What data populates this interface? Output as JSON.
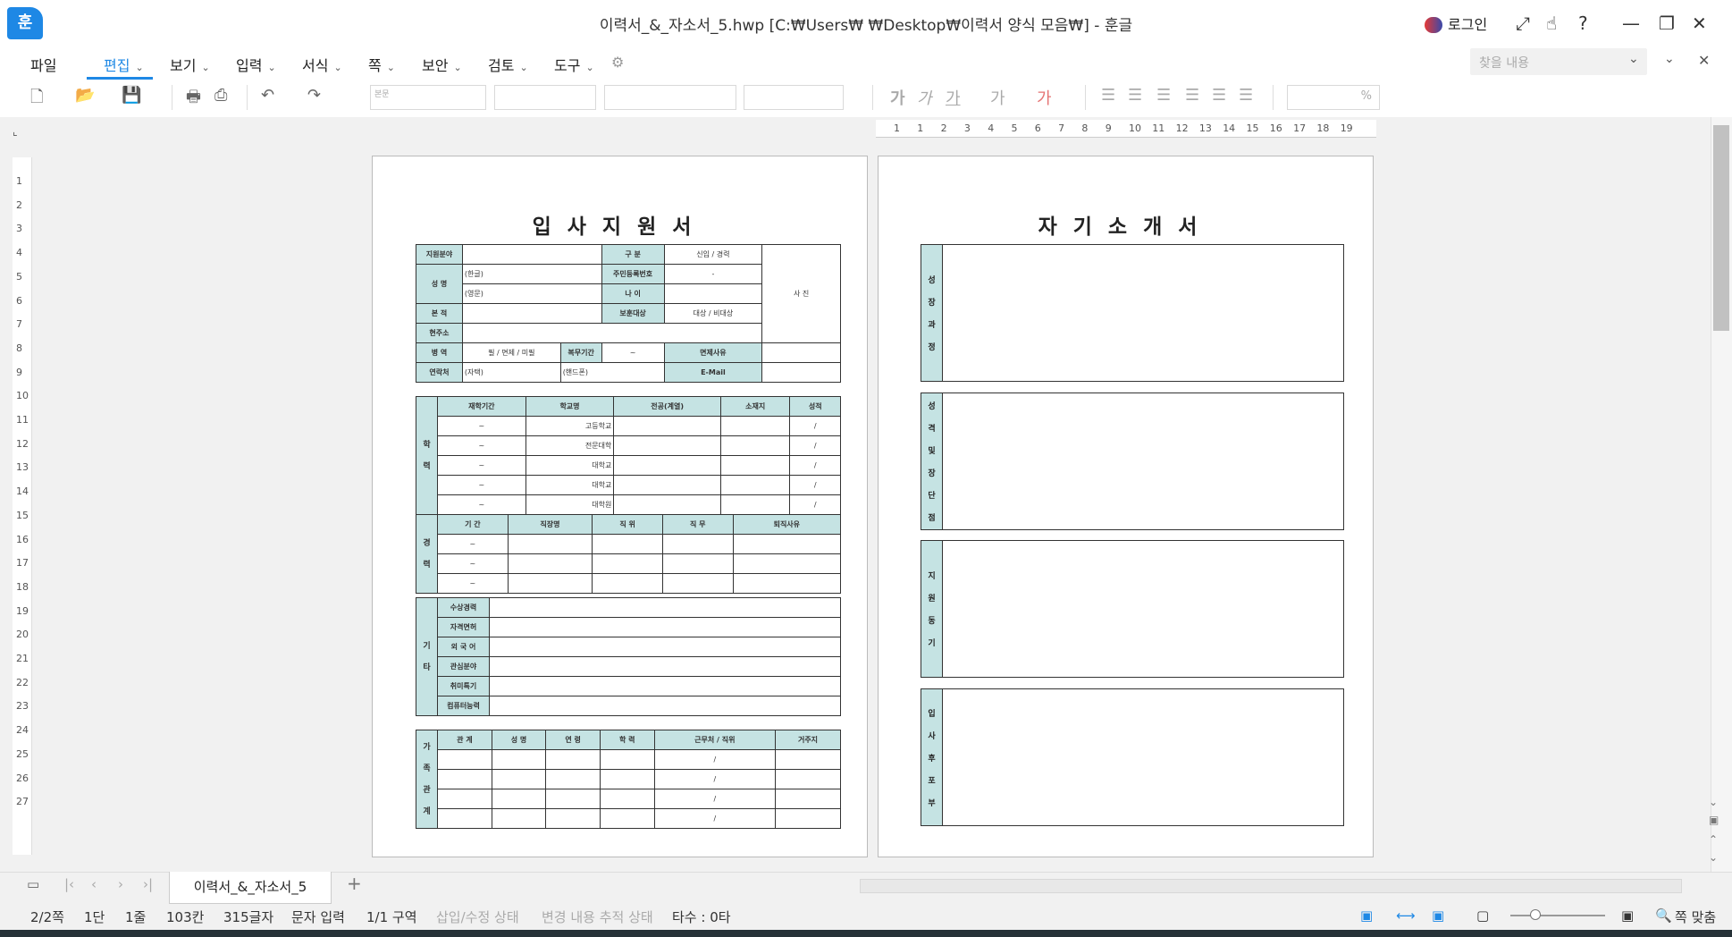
{
  "window": {
    "title": "이력서_&_자소서_5.hwp [C:₩Users₩      ₩Desktop₩이력서 양식 모음₩] - 훈글",
    "logo_glyph": "훈",
    "login": "로그인",
    "controls": {
      "fullscreen": "⤢",
      "touch": "☝",
      "help": "?",
      "minimize": "—",
      "restore": "❐",
      "close": "✕"
    }
  },
  "menu": {
    "items": [
      "파일",
      "편집",
      "보기",
      "입력",
      "서식",
      "쪽",
      "보안",
      "검토",
      "도구"
    ],
    "active": "편집",
    "search_placeholder": "찾을 내용"
  },
  "toolbar": {
    "style_value": "본문",
    "font_units": "%"
  },
  "ruler": {
    "h_numbers": [
      "1",
      "1",
      "2",
      "3",
      "4",
      "5",
      "6",
      "7",
      "8",
      "9",
      "10",
      "11",
      "12",
      "13",
      "14",
      "15",
      "16",
      "17",
      "18",
      "19"
    ],
    "v_numbers": [
      "1",
      "2",
      "3",
      "4",
      "5",
      "6",
      "7",
      "8",
      "9",
      "10",
      "11",
      "12",
      "13",
      "14",
      "15",
      "16",
      "17",
      "18",
      "19",
      "20",
      "21",
      "22",
      "23",
      "24",
      "25",
      "26",
      "27"
    ]
  },
  "form": {
    "title": "입사지원서",
    "info": {
      "field_label": "지원분야",
      "category_label": "구    분",
      "category_value": "신입 / 경력",
      "name_label": "성    명",
      "name_ko": "(한글)",
      "name_en": "(영문)",
      "id_label": "주민등록번호",
      "id_value": "-",
      "age_label": "나    이",
      "origin_label": "본    적",
      "veteran_label": "보훈대상",
      "veteran_value": "대상 / 비대상",
      "address_label": "현주소",
      "photo_label": "사 진",
      "military_label": "병    역",
      "military_value": "필 / 면제 / 미필",
      "service_label": "복무기간",
      "service_value": "~",
      "exempt_label": "면제사유",
      "contact_label": "연락처",
      "home": "(자택)",
      "mobile": "(핸드폰)",
      "email_label": "E-Mail"
    },
    "education": {
      "side": "학력",
      "headers": [
        "재학기간",
        "학교명",
        "전공(계열)",
        "소재지",
        "성적"
      ],
      "rows": [
        [
          "~",
          "고등학교",
          "",
          "",
          "/"
        ],
        [
          "~",
          "전문대학",
          "",
          "",
          "/"
        ],
        [
          "~",
          "대학교",
          "",
          "",
          "/"
        ],
        [
          "~",
          "대학교",
          "",
          "",
          "/"
        ],
        [
          "~",
          "대학원",
          "",
          "",
          "/"
        ]
      ]
    },
    "career": {
      "side": "경력",
      "headers": [
        "기 간",
        "직장명",
        "직 위",
        "직 무",
        "퇴직사유"
      ],
      "rows": [
        [
          "~",
          "",
          "",
          "",
          ""
        ],
        [
          "~",
          "",
          "",
          "",
          ""
        ],
        [
          "~",
          "",
          "",
          "",
          ""
        ]
      ]
    },
    "other": {
      "side": "기타",
      "labels": [
        "수상경력",
        "자격면허",
        "외 국 어",
        "관심분야",
        "취미특기",
        "컴퓨터능력"
      ]
    },
    "family": {
      "side": "가족관계",
      "headers": [
        "관 계",
        "성 명",
        "연 령",
        "학 력",
        "근무처 / 직위",
        "거주지"
      ],
      "rows": [
        [
          "",
          "",
          "",
          "",
          "/",
          ""
        ],
        [
          "",
          "",
          "",
          "",
          "/",
          ""
        ],
        [
          "",
          "",
          "",
          "",
          "/",
          ""
        ],
        [
          "",
          "",
          "",
          "",
          "/",
          ""
        ]
      ]
    }
  },
  "intro": {
    "title": "자기소개서",
    "sections": [
      "성장과정",
      "성격및장단점",
      "지원동기",
      "입사후포부"
    ]
  },
  "tabs": {
    "doc_tab": "이력서_&_자소서_5",
    "add": "+"
  },
  "status": {
    "page": "2/2쪽",
    "column": "1단",
    "line": "1줄",
    "col": "103칸",
    "chars": "315글자",
    "mode": "문자 입력",
    "section": "1/1 구역",
    "insert": "삽입/수정 상태",
    "track": "변경 내용 추적 상태",
    "typing": "타수 : 0타",
    "fit": "쪽 맞춤"
  }
}
